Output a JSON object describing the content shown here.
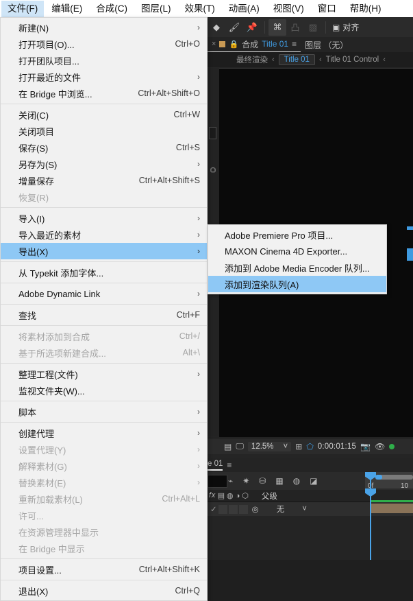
{
  "app": {
    "menubar": [
      {
        "label": "文件(F)",
        "active": true
      },
      {
        "label": "编辑(E)",
        "active": false
      },
      {
        "label": "合成(C)",
        "active": false
      },
      {
        "label": "图层(L)",
        "active": false
      },
      {
        "label": "效果(T)",
        "active": false
      },
      {
        "label": "动画(A)",
        "active": false
      },
      {
        "label": "视图(V)",
        "active": false
      },
      {
        "label": "窗口",
        "active": false
      },
      {
        "label": "帮助(H)",
        "active": false
      }
    ],
    "toolbar": {
      "align_label": "对齐",
      "icons": [
        "rotate-brush-icon",
        "roto-brush-icon",
        "puppet-pin-icon",
        "anchor-icon",
        "mask-icon",
        "shape-icon",
        "align-box-icon"
      ]
    },
    "panel_tabs": {
      "close_label": "×",
      "comp_label": "合成",
      "comp_name": "Title 01",
      "menu_glyph": "≡",
      "layer_label": "图层 （无）"
    },
    "breadcrumbs": {
      "final_render": "最终渲染",
      "active_comp": "Title 01",
      "control": "Title 01 Control",
      "chevron": "‹"
    },
    "viewer_bar": {
      "zoom": "12.5%",
      "chevron": "˅",
      "timecode": "0:00:01:15"
    },
    "timeline": {
      "tab_label": "e 01",
      "menu_glyph": "≡",
      "parent_header": "父级",
      "parent_value": "无",
      "ruler_start": "0f",
      "ruler_mark": "10"
    }
  },
  "file_menu": {
    "items": [
      {
        "label": "新建(N)",
        "accel": "",
        "arrow": true,
        "disabled": false,
        "highlight": false,
        "sep_after": false
      },
      {
        "label": "打开项目(O)...",
        "accel": "Ctrl+O",
        "arrow": false,
        "disabled": false,
        "highlight": false,
        "sep_after": false
      },
      {
        "label": "打开团队项目...",
        "accel": "",
        "arrow": false,
        "disabled": false,
        "highlight": false,
        "sep_after": false
      },
      {
        "label": "打开最近的文件",
        "accel": "",
        "arrow": true,
        "disabled": false,
        "highlight": false,
        "sep_after": false
      },
      {
        "label": "在 Bridge 中浏览...",
        "accel": "Ctrl+Alt+Shift+O",
        "arrow": false,
        "disabled": false,
        "highlight": false,
        "sep_after": true
      },
      {
        "label": "关闭(C)",
        "accel": "Ctrl+W",
        "arrow": false,
        "disabled": false,
        "highlight": false,
        "sep_after": false
      },
      {
        "label": "关闭项目",
        "accel": "",
        "arrow": false,
        "disabled": false,
        "highlight": false,
        "sep_after": false
      },
      {
        "label": "保存(S)",
        "accel": "Ctrl+S",
        "arrow": false,
        "disabled": false,
        "highlight": false,
        "sep_after": false
      },
      {
        "label": "另存为(S)",
        "accel": "",
        "arrow": true,
        "disabled": false,
        "highlight": false,
        "sep_after": false
      },
      {
        "label": "增量保存",
        "accel": "Ctrl+Alt+Shift+S",
        "arrow": false,
        "disabled": false,
        "highlight": false,
        "sep_after": false
      },
      {
        "label": "恢复(R)",
        "accel": "",
        "arrow": false,
        "disabled": true,
        "highlight": false,
        "sep_after": true
      },
      {
        "label": "导入(I)",
        "accel": "",
        "arrow": true,
        "disabled": false,
        "highlight": false,
        "sep_after": false
      },
      {
        "label": "导入最近的素材",
        "accel": "",
        "arrow": true,
        "disabled": false,
        "highlight": false,
        "sep_after": false
      },
      {
        "label": "导出(X)",
        "accel": "",
        "arrow": true,
        "disabled": false,
        "highlight": true,
        "sep_after": true
      },
      {
        "label": "从 Typekit 添加字体...",
        "accel": "",
        "arrow": false,
        "disabled": false,
        "highlight": false,
        "sep_after": true
      },
      {
        "label": "Adobe Dynamic Link",
        "accel": "",
        "arrow": true,
        "disabled": false,
        "highlight": false,
        "sep_after": true
      },
      {
        "label": "查找",
        "accel": "Ctrl+F",
        "arrow": false,
        "disabled": false,
        "highlight": false,
        "sep_after": true
      },
      {
        "label": "将素材添加到合成",
        "accel": "Ctrl+/",
        "arrow": false,
        "disabled": true,
        "highlight": false,
        "sep_after": false
      },
      {
        "label": "基于所选项新建合成...",
        "accel": "Alt+\\",
        "arrow": false,
        "disabled": true,
        "highlight": false,
        "sep_after": true
      },
      {
        "label": "整理工程(文件)",
        "accel": "",
        "arrow": true,
        "disabled": false,
        "highlight": false,
        "sep_after": false
      },
      {
        "label": "监视文件夹(W)...",
        "accel": "",
        "arrow": false,
        "disabled": false,
        "highlight": false,
        "sep_after": true
      },
      {
        "label": "脚本",
        "accel": "",
        "arrow": true,
        "disabled": false,
        "highlight": false,
        "sep_after": true
      },
      {
        "label": "创建代理",
        "accel": "",
        "arrow": true,
        "disabled": false,
        "highlight": false,
        "sep_after": false
      },
      {
        "label": "设置代理(Y)",
        "accel": "",
        "arrow": true,
        "disabled": true,
        "highlight": false,
        "sep_after": false
      },
      {
        "label": "解释素材(G)",
        "accel": "",
        "arrow": true,
        "disabled": true,
        "highlight": false,
        "sep_after": false
      },
      {
        "label": "替换素材(E)",
        "accel": "",
        "arrow": true,
        "disabled": true,
        "highlight": false,
        "sep_after": false
      },
      {
        "label": "重新加载素材(L)",
        "accel": "Ctrl+Alt+L",
        "arrow": false,
        "disabled": true,
        "highlight": false,
        "sep_after": false
      },
      {
        "label": "许可...",
        "accel": "",
        "arrow": false,
        "disabled": true,
        "highlight": false,
        "sep_after": false
      },
      {
        "label": "在资源管理器中显示",
        "accel": "",
        "arrow": false,
        "disabled": true,
        "highlight": false,
        "sep_after": false
      },
      {
        "label": "在 Bridge 中显示",
        "accel": "",
        "arrow": false,
        "disabled": true,
        "highlight": false,
        "sep_after": true
      },
      {
        "label": "项目设置...",
        "accel": "Ctrl+Alt+Shift+K",
        "arrow": false,
        "disabled": false,
        "highlight": false,
        "sep_after": true
      },
      {
        "label": "退出(X)",
        "accel": "Ctrl+Q",
        "arrow": false,
        "disabled": false,
        "highlight": false,
        "sep_after": false
      }
    ]
  },
  "export_submenu": {
    "items": [
      {
        "label": "Adobe Premiere Pro 项目...",
        "highlight": false
      },
      {
        "label": "MAXON Cinema 4D Exporter...",
        "highlight": false
      },
      {
        "label": "添加到 Adobe Media Encoder 队列...",
        "highlight": false
      },
      {
        "label": "添加到渲染队列(A)",
        "highlight": true
      }
    ]
  },
  "colors": {
    "menu_bg": "#f1f1f1",
    "highlight": "#8ec8f5",
    "menubar_active": "#cfe5f7",
    "app_accent": "#3f9ae0",
    "panel_bg": "#252525"
  }
}
